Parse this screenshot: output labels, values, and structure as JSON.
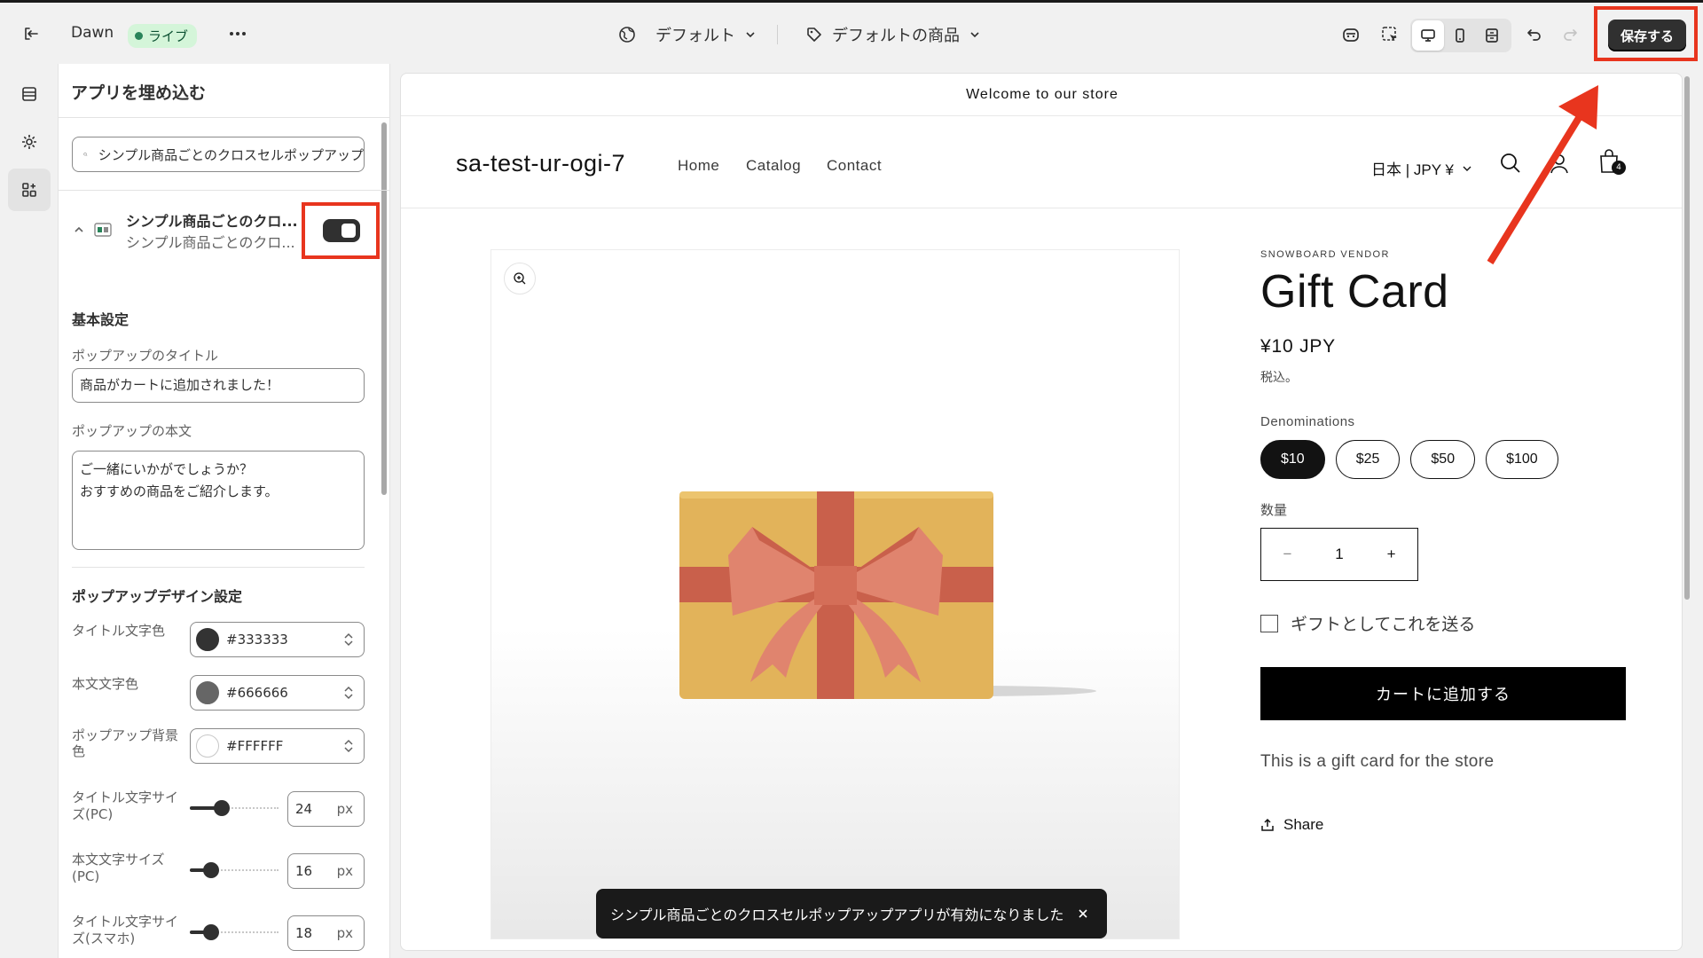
{
  "topbar": {
    "theme_name": "Dawn",
    "live_label": "ライブ",
    "template_dropdown": "デフォルト",
    "product_dropdown": "デフォルトの商品",
    "save_label": "保存する"
  },
  "panel": {
    "title": "アプリを埋め込む",
    "search_value": "シンプル商品ごとのクロスセルポップアップ",
    "app_name": "シンプル商品ごとのクロ...",
    "app_sub": "シンプル商品ごとのクロ...",
    "basic_section": "基本設定",
    "popup_title_label": "ポップアップのタイトル",
    "popup_title_value": "商品がカートに追加されました！",
    "popup_body_label": "ポップアップの本文",
    "popup_body_line1": "ご一緒にいかがでしょうか？",
    "popup_body_line2": "おすすめの商品をご紹介します。",
    "design_section": "ポップアップデザイン設定",
    "colors": [
      {
        "label": "タイトル文字色",
        "value": "#333333",
        "swatch": "#333333"
      },
      {
        "label": "本文文字色",
        "value": "#666666",
        "swatch": "#666666"
      },
      {
        "label": "ポップアップ背景色",
        "value": "#FFFFFF",
        "swatch": "#FFFFFF"
      }
    ],
    "sliders": [
      {
        "label": "タイトル文字サイズ(PC)",
        "value": "24",
        "unit": "px",
        "level": 0.3
      },
      {
        "label": "本文文字サイズ(PC)",
        "value": "16",
        "unit": "px",
        "level": 0.2
      },
      {
        "label": "タイトル文字サイズ(スマホ)",
        "value": "18",
        "unit": "px",
        "level": 0.2
      }
    ]
  },
  "store": {
    "announcement": "Welcome to our store",
    "logo": "sa-test-ur-ogi-7",
    "nav": [
      "Home",
      "Catalog",
      "Contact"
    ],
    "locale": "日本 | JPY ¥",
    "cart_count": "4",
    "vendor": "SNOWBOARD VENDOR",
    "product_title": "Gift Card",
    "price": "¥10 JPY",
    "tax_note": "税込。",
    "option_label": "Denominations",
    "options": [
      "$10",
      "$25",
      "$50",
      "$100"
    ],
    "qty_label": "数量",
    "qty_value": "1",
    "gift_check": "ギフトとしてこれを送る",
    "add_to_cart": "カートに追加する",
    "description": "This is a gift card for the store",
    "share": "Share"
  },
  "toast": {
    "message": "シンプル商品ごとのクロスセルポップアップアプリが有効になりました"
  },
  "colors": {
    "accent_red": "#e8351e",
    "primary_dark": "#303030",
    "live_green": "#29845a"
  }
}
